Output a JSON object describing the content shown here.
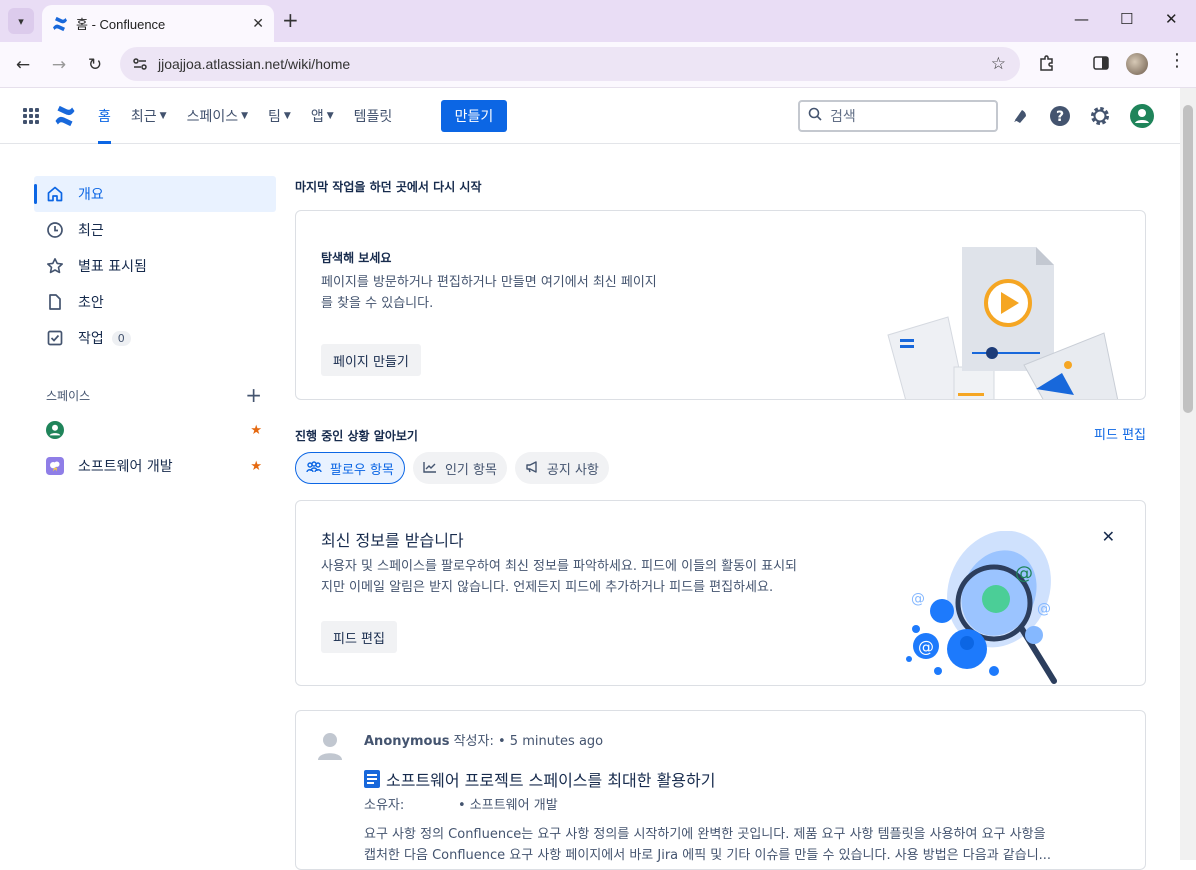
{
  "browser": {
    "tab_title": "홈 - Confluence",
    "url": "jjoajjoa.atlassian.net/wiki/home"
  },
  "header": {
    "nav": [
      {
        "label": "홈"
      },
      {
        "label": "최근"
      },
      {
        "label": "스페이스"
      },
      {
        "label": "팀"
      },
      {
        "label": "앱"
      },
      {
        "label": "템플릿"
      }
    ],
    "create_label": "만들기",
    "search_placeholder": "검색"
  },
  "sidebar": {
    "items": [
      {
        "label": "개요"
      },
      {
        "label": "최근"
      },
      {
        "label": "별표 표시됨"
      },
      {
        "label": "초안"
      },
      {
        "label": "작업",
        "badge": "0"
      }
    ],
    "spaces_label": "스페이스",
    "spaces": [
      {
        "label": ""
      },
      {
        "label": "소프트웨어 개발"
      }
    ]
  },
  "main": {
    "resume_title": "마지막 작업을 하던 곳에서 다시 시작",
    "explore_card": {
      "heading": "탐색해 보세요",
      "body_line1": "페이지를 방문하거나 편집하거나 만들면 여기에서 최신 페이지",
      "body_line2": "를 찾을 수 있습니다.",
      "button": "페이지 만들기"
    },
    "progress_title": "진행 중인 상황 알아보기",
    "feed_edit_link": "피드 편집",
    "pills": [
      {
        "label": "팔로우 항목"
      },
      {
        "label": "인기 항목"
      },
      {
        "label": "공지 사항"
      }
    ],
    "updates_card": {
      "heading": "최신 정보를 받습니다",
      "body_line1": "사용자 및 스페이스를 팔로우하여 최신 정보를 파악하세요. 피드에 이들의 활동이 표시되",
      "body_line2": "지만 이메일 알림은 받지 않습니다. 언제든지 피드에 추가하거나 피드를 편집하세요.",
      "button": "피드 편집"
    },
    "activity": {
      "author": "Anonymous",
      "meta": "작성자: • 5 minutes ago",
      "page_title": "소프트웨어 프로젝트 스페이스를 최대한 활용하기",
      "owner_label": "소유자:",
      "owner_value": "• 소프트웨어 개발",
      "excerpt_line1": "요구 사항 정의 Confluence는 요구 사항 정의를 시작하기에 완벽한 곳입니다. 제품 요구 사항 템플릿을 사용하여 요구 사항을",
      "excerpt_line2": "캡처한 다음 Confluence 요구 사항 페이지에서 바로 Jira 에픽 및 기타 이슈를 만들 수 있습니다. 사용 방법은 다음과 같습니..."
    }
  },
  "colors": {
    "accent": "#0c66e4",
    "star": "#e56910",
    "avatar_green": "#1f845a"
  }
}
